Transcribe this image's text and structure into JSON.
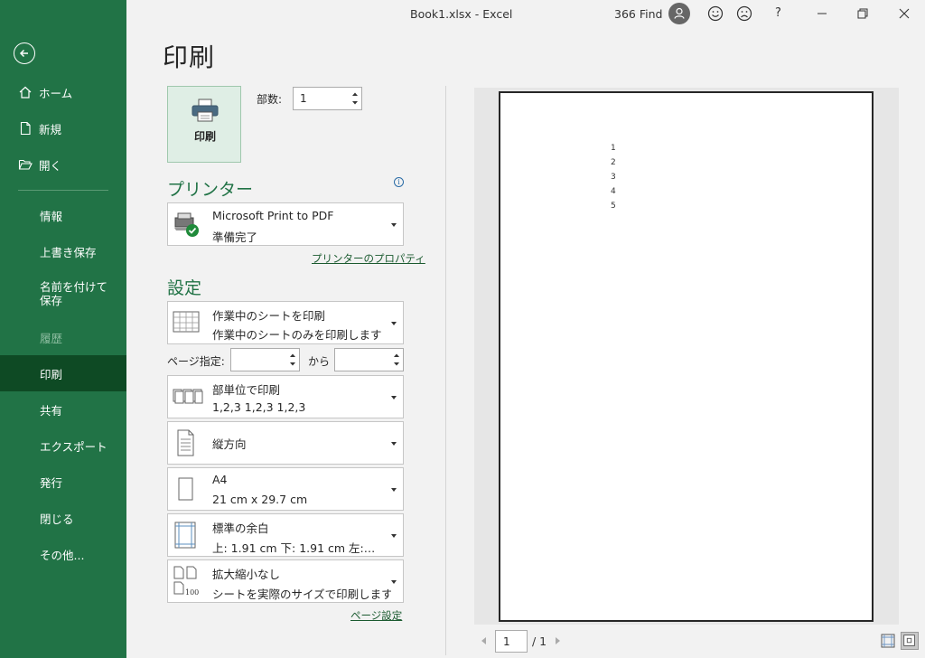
{
  "window": {
    "title": "Book1.xlsx  -  Excel",
    "find_label": "366 Find",
    "help": "?"
  },
  "sidebar": {
    "items": [
      {
        "label": "ホーム"
      },
      {
        "label": "新規"
      },
      {
        "label": "開く"
      },
      {
        "label": "情報"
      },
      {
        "label": "上書き保存"
      },
      {
        "label": "名前を付けて保存"
      },
      {
        "label": "履歴"
      },
      {
        "label": "印刷"
      },
      {
        "label": "共有"
      },
      {
        "label": "エクスポート"
      },
      {
        "label": "発行"
      },
      {
        "label": "閉じる"
      },
      {
        "label": "その他..."
      }
    ],
    "active": "印刷",
    "disabled": "履歴"
  },
  "page": {
    "title": "印刷"
  },
  "print": {
    "button_label": "印刷",
    "copies_label": "部数:",
    "copies_value": "1"
  },
  "printer": {
    "section_title": "プリンター",
    "name": "Microsoft Print to PDF",
    "status": "準備完了",
    "properties_link": "プリンターのプロパティ"
  },
  "settings": {
    "section_title": "設定",
    "scope": {
      "line1": "作業中のシートを印刷",
      "line2": "作業中のシートのみを印刷します"
    },
    "pages_label": "ページ指定:",
    "pages_to_label": "から",
    "pages_from_value": "",
    "pages_to_value": "",
    "collate": {
      "line1": "部単位で印刷",
      "line2": "1,2,3    1,2,3    1,2,3"
    },
    "orientation": {
      "line1": "縦方向"
    },
    "paper": {
      "line1": "A4",
      "line2": "21 cm x 29.7 cm"
    },
    "margins": {
      "line1": "標準の余白",
      "line2": "上: 1.91 cm 下: 1.91 cm 左:…"
    },
    "scaling": {
      "line1": "拡大縮小なし",
      "line2": "シートを実際のサイズで印刷します"
    },
    "page_setup_link": "ページ設定"
  },
  "preview": {
    "cells": [
      "1",
      "2",
      "3",
      "4",
      "5"
    ],
    "current_page": "1",
    "total_pages": "/ 1"
  },
  "colors": {
    "accent": "#217346",
    "active_nav": "#0e4a24"
  }
}
